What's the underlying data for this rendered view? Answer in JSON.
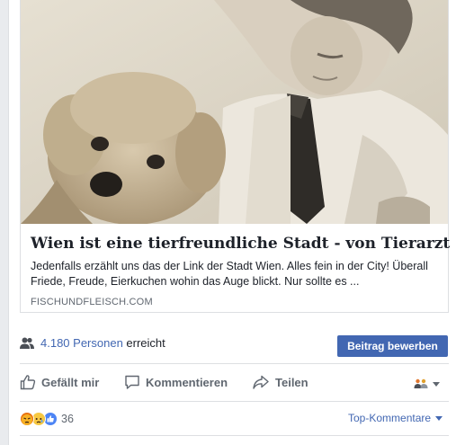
{
  "link_preview": {
    "image_description_icon": "photo-man-with-dog",
    "title": "Wien ist eine tierfreundliche Stadt - von Tierarzt",
    "description": "Jedenfalls erzählt uns das der Link der Stadt Wien. Alles fein in der City! Überall Friede, Freude, Eierkuchen wohin das Auge blickt. Nur sollte es ...",
    "domain": "FISCHUNDFLEISCH.COM"
  },
  "reach": {
    "icon": "people-icon",
    "count_text": "4.180 Personen",
    "label": "erreicht",
    "boost_button": "Beitrag bewerben"
  },
  "actions": {
    "like": "Gefällt mir",
    "comment": "Kommentieren",
    "share": "Teilen",
    "audience_icon": "friends-icon"
  },
  "reactions": {
    "icons": [
      "angry-icon",
      "sad-icon",
      "like-icon"
    ],
    "count": "36",
    "sort_label": "Top-Kommentare"
  },
  "colors": {
    "accent": "#4267b2",
    "muted": "#606770",
    "text": "#1d2129",
    "border": "#dddfe2"
  }
}
